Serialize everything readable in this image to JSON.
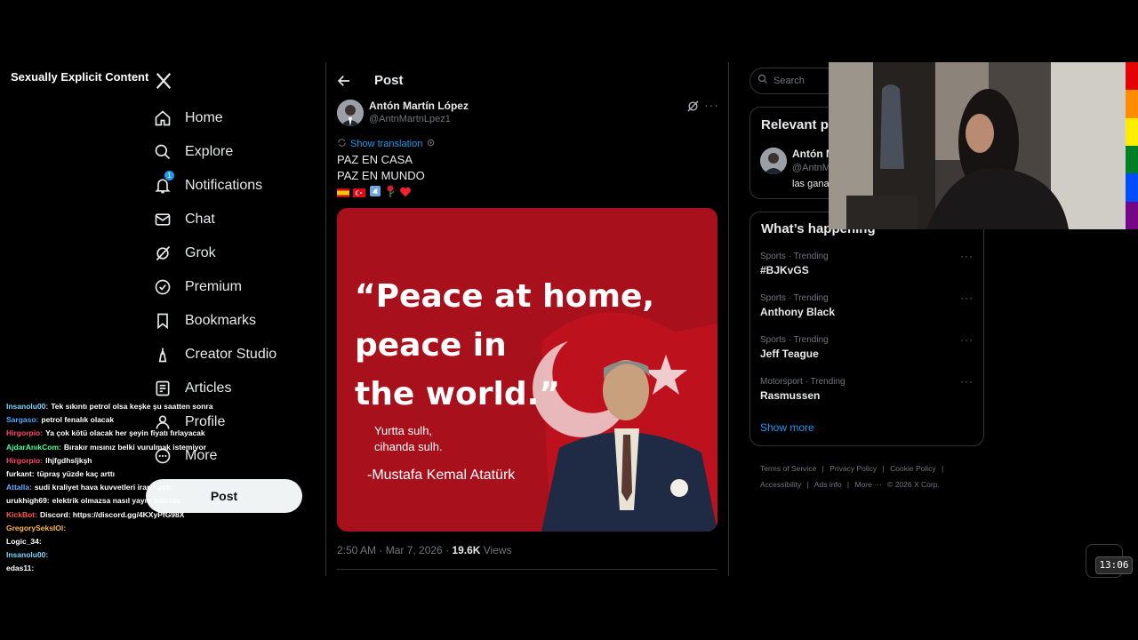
{
  "overlay": {
    "label": "Sexually Explicit Content"
  },
  "nav": {
    "items": [
      {
        "label": "Home",
        "icon": "home-icon"
      },
      {
        "label": "Explore",
        "icon": "search-icon"
      },
      {
        "label": "Notifications",
        "icon": "bell-icon",
        "badge": "1"
      },
      {
        "label": "Chat",
        "icon": "mail-icon"
      },
      {
        "label": "Grok",
        "icon": "grok-icon"
      },
      {
        "label": "Premium",
        "icon": "verified-icon"
      },
      {
        "label": "Bookmarks",
        "icon": "bookmark-icon"
      },
      {
        "label": "Creator Studio",
        "icon": "creator-icon"
      },
      {
        "label": "Articles",
        "icon": "article-icon"
      },
      {
        "label": "Profile",
        "icon": "person-icon"
      },
      {
        "label": "More",
        "icon": "more-circle-icon"
      }
    ],
    "post_button": "Post"
  },
  "main": {
    "header_title": "Post",
    "author": {
      "name": "Antón Martín López",
      "handle": "@AntnMartnLpez1"
    },
    "show_translation": "Show translation",
    "text_lines": [
      "PAZ EN CASA",
      "PAZ EN MUNDO"
    ],
    "emojis": [
      "spain-flag",
      "turkey-flag",
      "dove",
      "rose",
      "heart"
    ],
    "image": {
      "quote": "“Peace at home,\npeace in\nthe world.”",
      "turkish": "Yurtta sulh,\ncihanda sulh.",
      "attribution": "-Mustafa Kemal Atatürk"
    },
    "meta": {
      "time": "2:50 AM · Mar 7, 2026 · ",
      "views_count": "19.6K",
      "views_label": " Views"
    }
  },
  "sidebar": {
    "search_placeholder": "Search",
    "relevant": {
      "title": "Relevant p",
      "name": "Antón M",
      "handle": "@AntnM",
      "bio": "las gana"
    },
    "happening": {
      "title": "What’s happening",
      "trends": [
        {
          "category": "Sports · Trending",
          "name": "#BJKvGS"
        },
        {
          "category": "Sports · Trending",
          "name": "Anthony Black"
        },
        {
          "category": "Sports · Trending",
          "name": "Jeff Teague"
        },
        {
          "category": "Motorsport · Trending",
          "name": "Rasmussen"
        }
      ],
      "show_more": "Show more"
    },
    "footer": [
      "Terms of Service",
      "|",
      "Privacy Policy",
      "|",
      "Cookie Policy",
      "|",
      "Accessibility",
      "|",
      "Ads info",
      "|",
      "More ···",
      "© 2026 X Corp."
    ]
  },
  "chat": [
    {
      "user": "Insanolu00:",
      "color": "#7fd8ff",
      "msg": "Tek sıkıntı petrol olsa keşke şu saatten sonra"
    },
    {
      "user": "Sargaso:",
      "color": "#4aa8ff",
      "msg": "petrol fenalık olacak"
    },
    {
      "user": "Hirgorpio:",
      "color": "#ff4a6a",
      "msg": "Ya çok kötü olacak her şeyin fiyatı fırlayacak"
    },
    {
      "user": "AjdarAnıkCom:",
      "color": "#4aff9a",
      "msg": "Bırakır mısınız belki vurulmak istemiyor"
    },
    {
      "user": "Hirgorpio:",
      "color": "#ff4a6a",
      "msg": "lhjfgdhsljkşh"
    },
    {
      "user": "furkant:",
      "color": "#ffffff",
      "msg": "tüpraş yüzde kaç arttı"
    },
    {
      "user": "Attalla:",
      "color": "#6aa8ff",
      "msg": "sudi kraliyet hava kuvvetleri iran kaçtı"
    },
    {
      "user": "urukhigh69:",
      "color": "#ffffff",
      "msg": "elektrik olmazsa nasıl yayın bakıcaz"
    },
    {
      "user": "KickBot:",
      "color": "#ff5555",
      "msg": "Discord: https://discord.gg/4KXyPfG98X"
    },
    {
      "user": "GregorySeksIOl:",
      "color": "#ffb84a",
      "msg": ""
    },
    {
      "user": "Logic_34:",
      "color": "#ffffff",
      "msg": ""
    },
    {
      "user": "Insanolu00:",
      "color": "#7fd8ff",
      "msg": ""
    },
    {
      "user": "edas11:",
      "color": "#ffffff",
      "msg": ""
    }
  ],
  "clock": "13:06",
  "colors": {
    "accent": "#1d9bf0",
    "bg": "#000000",
    "border": "#2f3336",
    "image_red": "#b0111d"
  }
}
